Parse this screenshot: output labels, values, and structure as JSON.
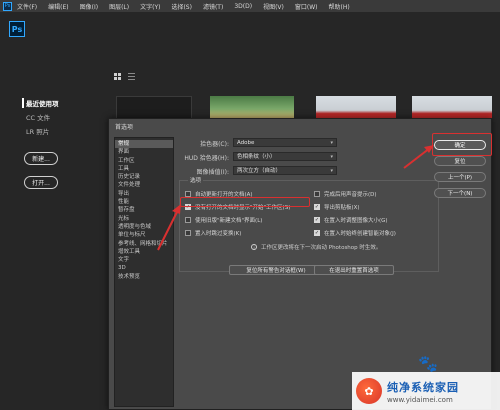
{
  "menubar": {
    "app_icon": "Ps",
    "items": [
      "文件(F)",
      "编辑(E)",
      "图像(I)",
      "图层(L)",
      "文字(Y)",
      "选择(S)",
      "滤镜(T)",
      "3D(D)",
      "视图(V)",
      "窗口(W)",
      "帮助(H)"
    ]
  },
  "home": {
    "logo": "Ps",
    "nav": [
      "最近使用项",
      "CC 文件",
      "LR 照片"
    ],
    "new_button": "新建...",
    "open_button": "打开..."
  },
  "dialog": {
    "title": "首选项",
    "categories": [
      "常规",
      "界面",
      "工作区",
      "工具",
      "历史记录",
      "文件处理",
      "导出",
      "性能",
      "暂存盘",
      "光标",
      "透明度与色域",
      "单位与标尺",
      "参考线、网格和切片",
      "增效工具",
      "文字",
      "3D",
      "技术预览"
    ],
    "selected_category": "常规",
    "fields": {
      "color_picker_label": "拾色器(C):",
      "color_picker_value": "Adobe",
      "hud_label": "HUD 拾色器(H):",
      "hud_value": "色相条纹（小）",
      "interp_label": "图像插值(I):",
      "interp_value": "两次立方（自动）"
    },
    "options_title": "选项",
    "options_left": [
      {
        "label": "自动更新打开的文档(A)",
        "checked": false
      },
      {
        "label": "没有打开的文档时显示\"开始\"工作区(S)",
        "checked": true
      },
      {
        "label": "使用旧版\"新建文档\"界面(L)",
        "checked": false
      },
      {
        "label": "置入时跳过变换(K)",
        "checked": false
      }
    ],
    "options_right": [
      {
        "label": "完成后用声音提示(D)",
        "checked": false
      },
      {
        "label": "导出剪贴板(X)",
        "checked": true
      },
      {
        "label": "在置入时调整图像大小(G)",
        "checked": true
      },
      {
        "label": "在置入时始终创建智能对象(J)",
        "checked": true
      }
    ],
    "info_text": "工作区更改将在下一次启动 Photoshop 时生效。",
    "reset_warnings": "复位所有警告对话框(W)",
    "reset_on_quit": "在退出时重置首选项",
    "buttons": {
      "ok": "确定",
      "reset": "复位",
      "prev": "上一个(P)",
      "next": "下一个(N)"
    }
  },
  "watermark": {
    "title": "纯净系统家园",
    "url": "www.yidaimei.com"
  },
  "colors": {
    "accent": "#31a8ff",
    "highlight": "#d93030"
  }
}
